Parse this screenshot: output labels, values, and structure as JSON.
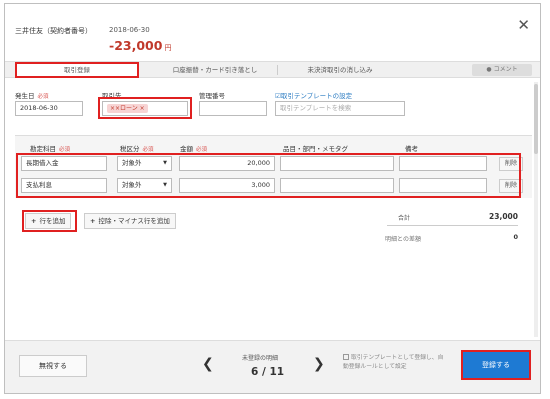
{
  "header": {
    "bank_name": "三井住友（契約者番号）",
    "date": "2018-06-30",
    "amount": "-23,000",
    "amount_unit": "円",
    "close_icon": "close-icon"
  },
  "tabs": [
    {
      "label": "取引登録"
    },
    {
      "label": "口座振替・カード引き落とし"
    },
    {
      "label": "未決済取引の消し込み"
    }
  ],
  "comment_label": "コメント",
  "form": {
    "date_label": "発生日",
    "required": "必須",
    "date_value": "2018-06-30",
    "partner_label": "取引先",
    "partner_tag": "××ローン ×",
    "mgmt_label": "管理番号",
    "template_link": "取引テンプレートの設定",
    "template_placeholder": "取引テンプレートを検索"
  },
  "table": {
    "headers": {
      "account": "勘定科目",
      "tax": "税区分",
      "amount": "金額",
      "item": "品目・部門・メモタグ",
      "note": "備考"
    },
    "rows": [
      {
        "account": "長期借入金",
        "tax": "対象外",
        "amount": "20,000",
        "delete": "削除"
      },
      {
        "account": "支払利息",
        "tax": "対象外",
        "amount": "3,000",
        "delete": "削除"
      }
    ]
  },
  "actions": {
    "add_row": "行を追加",
    "add_adjust_row": "控除・マイナス行を追加"
  },
  "summary": {
    "total_label": "合計",
    "total_value": "23,000",
    "diff_label": "明細との差額",
    "diff_value": "0"
  },
  "footer": {
    "ignore": "無視する",
    "unregistered_label": "未登録の明細",
    "pager": "6 / 11",
    "template_check": "取引テンプレートとして登録し、自動登録ルールとして設定",
    "register": "登録する"
  }
}
